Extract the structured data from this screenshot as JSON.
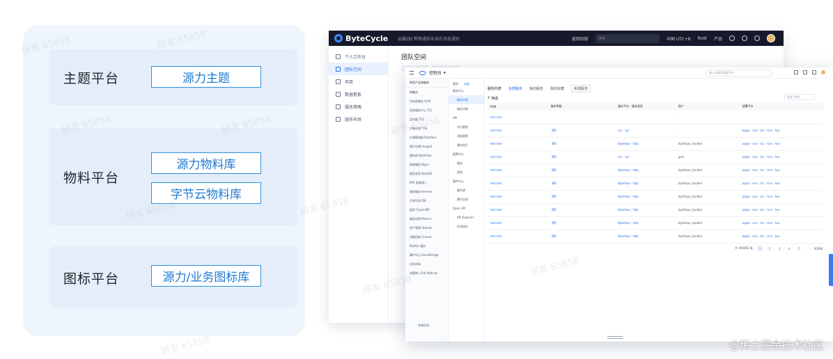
{
  "platforms": [
    {
      "title": "主题平台",
      "tags": [
        "源力主题"
      ]
    },
    {
      "title": "物料平台",
      "tags": [
        "源力物料库",
        "字节云物料库"
      ]
    },
    {
      "title": "图标平台",
      "tags": [
        "源力/业务图标库"
      ]
    }
  ],
  "console_back": {
    "brand": "ByteCycle",
    "notice_prefix": "公告(3)",
    "notice_text": "等等通知未读的消息通知",
    "nav": [
      "返回旧版",
      "中国 UTC+8",
      "RoW",
      "产品"
    ],
    "search_placeholder": "搜索",
    "sidebar": [
      "个人工作台",
      "团队空间",
      "项目",
      "数据看板",
      "服务策略",
      "服务市场"
    ],
    "heading": "团队空间"
  },
  "console_front": {
    "title": "控制台",
    "search_placeholder": "输入关键词搜索平台",
    "left_menu": [
      "控制台",
      "代码库服务 SCM",
      "消息服务中心 TCC",
      "定时器 TCE",
      "对象存储 TOS",
      "大规模流量 Bytefaas",
      "图片存储 ImageX",
      "服务网 ByteFlow",
      "网络服务 Ngou",
      "服务发现 ByteSD",
      "RPC 框架接入",
      "通知服务 Hermes",
      "开发环境 IDE",
      "监控 Cloud IDE",
      "服务治理 Metrics",
      "资产管理 Stander",
      "流量回放 Chrono",
      "MySQL 服务",
      "事件中心 EventBridge",
      "应用市场",
      "流量转入平台 NetLink"
    ],
    "left_menu_header": "常用产品和服务",
    "bottom_link": "申请试用",
    "mid_tabs": [
      "我的",
      "全部"
    ],
    "mid_menu": [
      {
        "label": "服务中心",
        "sub": false
      },
      {
        "label": "服务列表",
        "sub": true,
        "active": true
      },
      {
        "label": "服务详情",
        "sub": true
      },
      {
        "label": "API",
        "sub": false
      },
      {
        "label": "节点管理",
        "sub": true
      },
      {
        "label": "流量管理",
        "sub": true
      },
      {
        "label": "服务账号",
        "sub": true
      },
      {
        "label": "配置中心",
        "sub": false
      },
      {
        "label": "路由",
        "sub": true
      },
      {
        "label": "规则",
        "sub": true
      },
      {
        "label": "事件中心",
        "sub": false
      },
      {
        "label": "事件源",
        "sub": true
      },
      {
        "label": "事件总线",
        "sub": true
      },
      {
        "label": "Open API",
        "sub": false
      },
      {
        "label": "API Explorer",
        "sub": true
      },
      {
        "label": "在线调试",
        "sub": true
      }
    ],
    "main_head": {
      "title": "服务列表",
      "tabs": [
        "全部服务",
        "我的服务",
        "我的收藏"
      ],
      "button": "新建服务"
    },
    "filter_label": "筛选",
    "filter_placeholder": "搜索 PSM",
    "table_headers": [
      "PSM",
      "服务等级",
      "服务平台 · 服务类型",
      "租户",
      "部署平台"
    ],
    "rows": [
      {
        "psm": "test.test",
        "level": "",
        "type": "",
        "tenant": "-",
        "platform": ""
      },
      {
        "psm": "test.test",
        "level": "P0",
        "type": "tce · rpc",
        "tenant": "-",
        "platform": "argos · env · tcc · tcm · kes"
      },
      {
        "psm": "test.test",
        "level": "P0",
        "type": "Bytefaas · http",
        "tenant": "bytefaas_handler",
        "platform": "argos · env · tcc · tcm · kes"
      },
      {
        "psm": "test.test",
        "level": "P0",
        "type": "tce · rpc",
        "tenant": "golu",
        "platform": "argos · env · tcc · tcm · kes"
      },
      {
        "psm": "test.test",
        "level": "P0",
        "type": "Bytefaas · http",
        "tenant": "bytefaas_handler",
        "platform": "argos · env · tcc · tcm · kes"
      },
      {
        "psm": "test.test",
        "level": "P0",
        "type": "Bytefaas · http",
        "tenant": "bytefaas_handler",
        "platform": "argos · env · tcc · tcm · kes"
      },
      {
        "psm": "test.test",
        "level": "P0",
        "type": "Bytefaas · http",
        "tenant": "bytefaas_handler",
        "platform": "argos · env · tcc · tcm · kes"
      },
      {
        "psm": "test.test",
        "level": "P0",
        "type": "Bytefaas · http",
        "tenant": "bytefaas_handler",
        "platform": "argos · env · tcc · tcm · kes"
      },
      {
        "psm": "test.test",
        "level": "P0",
        "type": "Bytefaas · http",
        "tenant": "bytefaas_handler",
        "platform": "argos · env · tcc · tcm · kes"
      },
      {
        "psm": "test.test",
        "level": "P0",
        "type": "Bytefaas · http",
        "tenant": "bytefaas_handler",
        "platform": "argos · env · tcc · tcm · kes"
      }
    ],
    "pager": {
      "total": "共 300862 条",
      "pages": [
        "1",
        "2",
        "3",
        "4",
        "5",
        "…",
        "30086"
      ]
    }
  },
  "watermark": "研发 65858",
  "credit": "@稀土掘金技术社区",
  "colors": {
    "accent": "#2f8fd8",
    "panel": "#eef5fd",
    "topbar": "#16192a"
  }
}
